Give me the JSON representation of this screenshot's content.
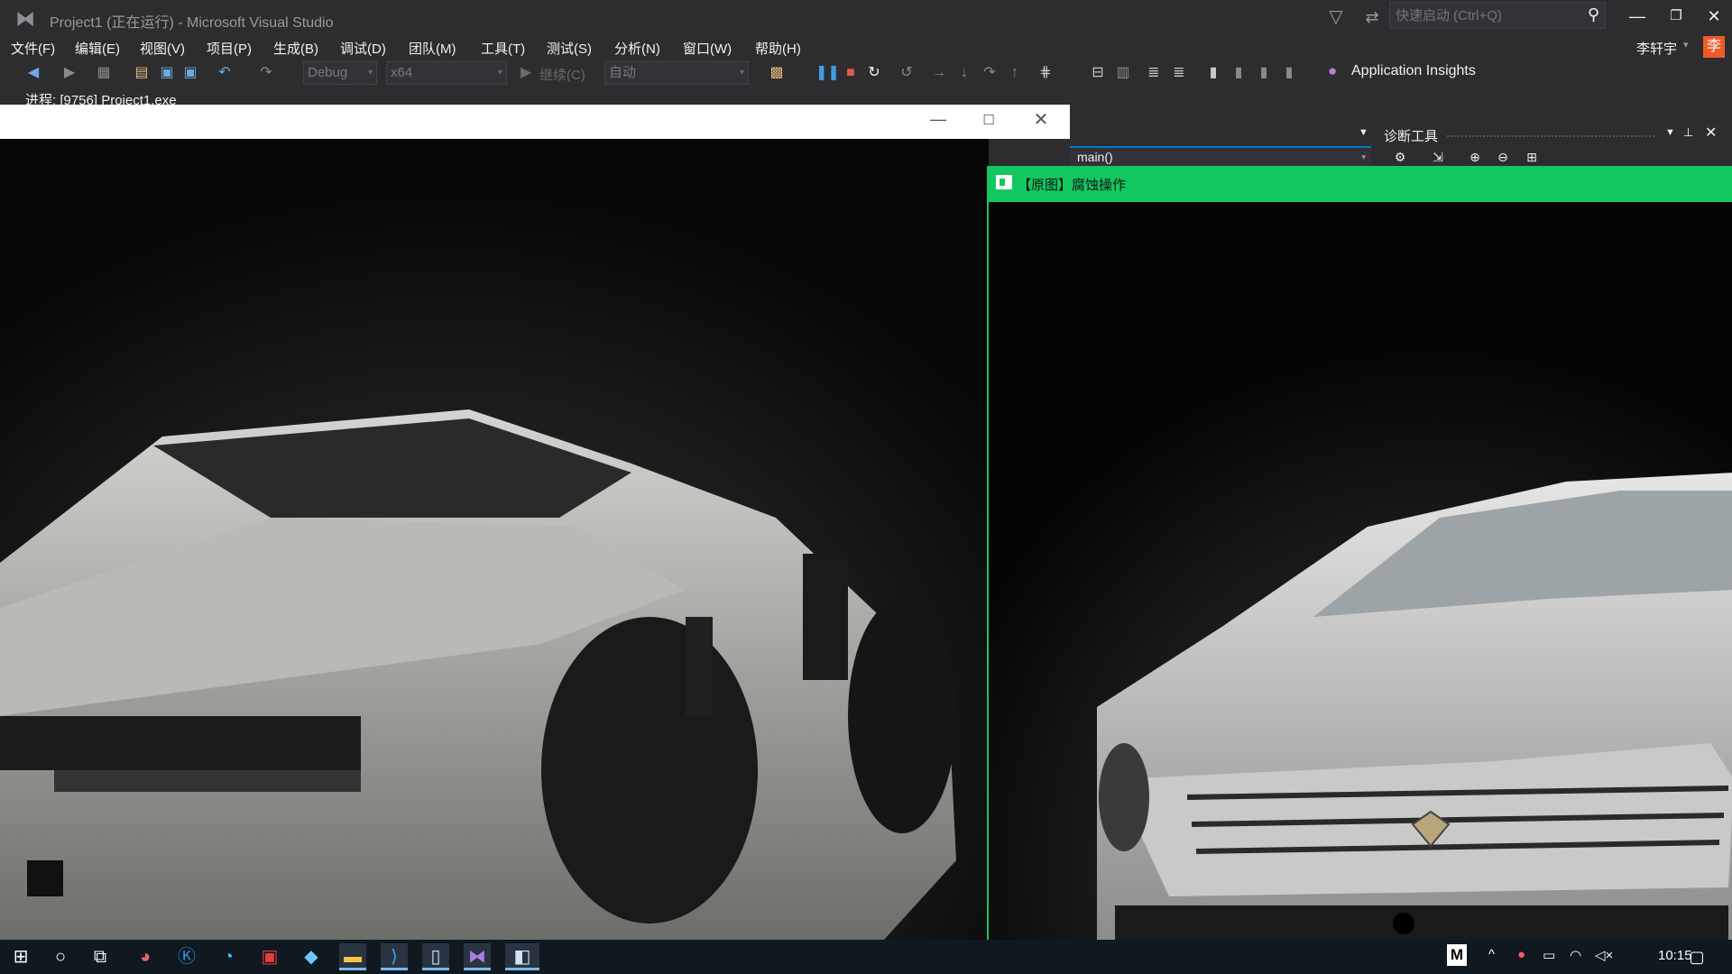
{
  "vs": {
    "title": "Project1 (正在运行) - Microsoft Visual Studio",
    "quick_launch_placeholder": "快速启动 (Ctrl+Q)",
    "menu": [
      "文件(F)",
      "编辑(E)",
      "视图(V)",
      "项目(P)",
      "生成(B)",
      "调试(D)",
      "团队(M)",
      "工具(T)",
      "测试(S)",
      "分析(N)",
      "窗口(W)",
      "帮助(H)"
    ],
    "user": "李轩宇",
    "user_initial": "李",
    "toolbar": {
      "config": "Debug",
      "platform": "x64",
      "continue": "继续(C)",
      "auto": "自动",
      "app_insights": "Application Insights"
    },
    "process": "进程:  [9756] Project1.exe",
    "diag_title": "诊断工具",
    "function": "main()"
  },
  "eroded_window": {
    "title": ""
  },
  "original_window": {
    "title": "【原图】腐蚀操作"
  },
  "taskbar": {
    "clock": "10:15"
  },
  "colors": {
    "accent": "#007acc",
    "opencv_title": "#13c760",
    "avatar": "#f05a28"
  }
}
